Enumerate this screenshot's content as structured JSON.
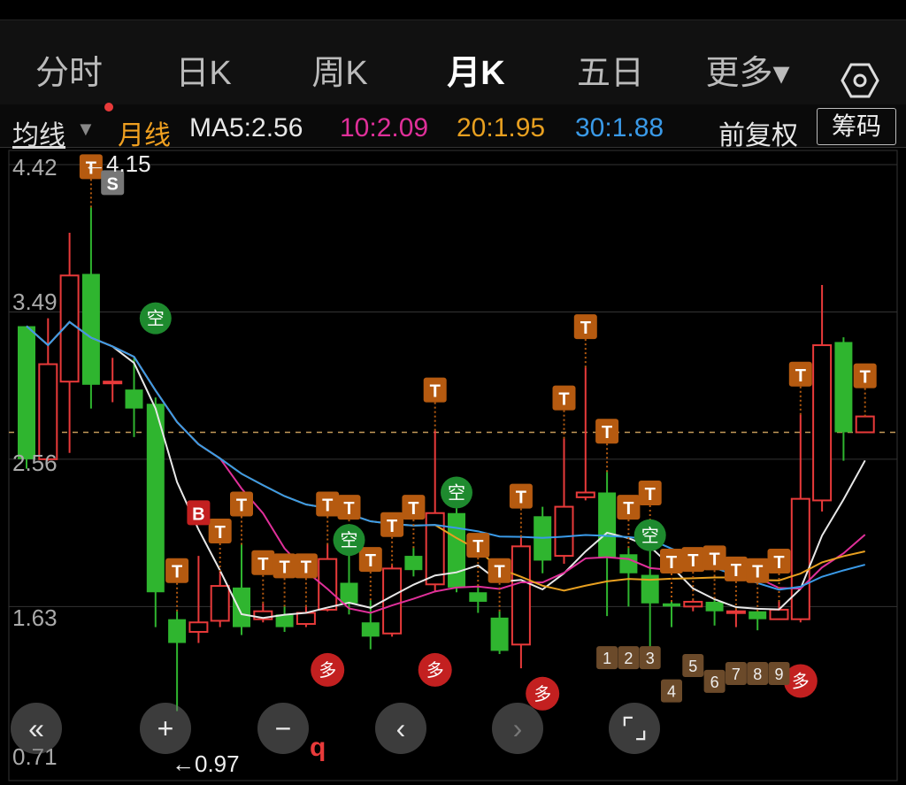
{
  "tabs": [
    {
      "label": "分时"
    },
    {
      "label": "日K"
    },
    {
      "label": "周K"
    },
    {
      "label": "月K"
    },
    {
      "label": "五日"
    },
    {
      "label": "更多▾"
    }
  ],
  "ma_bar": {
    "type_label": "均线",
    "period_label": "月线",
    "ma5": "MA5:2.56",
    "ma10": "10:2.09",
    "ma20": "20:1.95",
    "ma30": "30:1.88",
    "adjust": "前复权",
    "chips": "筹码",
    "colors": {
      "period": "#f0a020",
      "ma5": "#e8e8e8",
      "ma10": "#e0309a",
      "ma20": "#e8a020",
      "ma30": "#3a9ae8"
    }
  },
  "price_labels": {
    "top": "4.42",
    "mid_high": "3.49",
    "mid": "2.56",
    "mid_low": "1.63",
    "bottom": "0.71"
  },
  "annotations": {
    "high": "←4.15",
    "low": "←0.97"
  },
  "markers": {
    "T": "T",
    "S": "S",
    "B": "B",
    "kong": "空",
    "duo": "多",
    "numbers": [
      "1",
      "2",
      "3",
      "4",
      "5",
      "6",
      "7",
      "8",
      "9"
    ],
    "q": "q"
  },
  "colors": {
    "up": "#e83a3a",
    "down": "#2fb52f",
    "marker_t": "#b55a10",
    "kong_bg": "#1e8a2e",
    "duo_bg": "#c32020"
  },
  "chart_data": {
    "type": "candlestick",
    "ylim": [
      0.71,
      4.42
    ],
    "candles": [
      {
        "o": 2.56,
        "c": 3.4,
        "h": 3.4,
        "l": 2.5,
        "up": false
      },
      {
        "o": 2.56,
        "c": 3.16,
        "h": 3.45,
        "l": 2.55,
        "up": true
      },
      {
        "o": 3.05,
        "c": 3.72,
        "h": 3.99,
        "l": 2.6,
        "up": true
      },
      {
        "o": 3.73,
        "c": 3.03,
        "h": 4.15,
        "l": 2.88,
        "up": false
      },
      {
        "o": 3.05,
        "c": 3.05,
        "h": 3.2,
        "l": 2.92,
        "up": true
      },
      {
        "o": 3.0,
        "c": 2.88,
        "h": 3.2,
        "l": 2.7,
        "up": false
      },
      {
        "o": 2.91,
        "c": 1.72,
        "h": 2.95,
        "l": 1.5,
        "up": false
      },
      {
        "o": 1.55,
        "c": 1.4,
        "h": 1.6,
        "l": 0.97,
        "up": false
      },
      {
        "o": 1.47,
        "c": 1.53,
        "h": 1.95,
        "l": 1.4,
        "up": true
      },
      {
        "o": 1.54,
        "c": 1.76,
        "h": 1.85,
        "l": 1.5,
        "up": true
      },
      {
        "o": 1.75,
        "c": 1.5,
        "h": 2.02,
        "l": 1.45,
        "up": false
      },
      {
        "o": 1.55,
        "c": 1.6,
        "h": 1.65,
        "l": 1.53,
        "up": true
      },
      {
        "o": 1.58,
        "c": 1.5,
        "h": 1.63,
        "l": 1.47,
        "up": false
      },
      {
        "o": 1.52,
        "c": 1.59,
        "h": 1.63,
        "l": 1.5,
        "up": true
      },
      {
        "o": 1.61,
        "c": 1.93,
        "h": 2.02,
        "l": 1.6,
        "up": true
      },
      {
        "o": 1.78,
        "c": 1.65,
        "h": 2.0,
        "l": 1.58,
        "up": false
      },
      {
        "o": 1.53,
        "c": 1.44,
        "h": 1.67,
        "l": 1.36,
        "up": false
      },
      {
        "o": 1.46,
        "c": 1.87,
        "h": 1.89,
        "l": 1.44,
        "up": true
      },
      {
        "o": 1.86,
        "c": 1.95,
        "h": 2.0,
        "l": 1.82,
        "up": false
      },
      {
        "o": 1.77,
        "c": 2.22,
        "h": 2.74,
        "l": 1.73,
        "up": true
      },
      {
        "o": 2.22,
        "c": 1.75,
        "h": 2.25,
        "l": 1.72,
        "up": false
      },
      {
        "o": 1.72,
        "c": 1.66,
        "h": 1.76,
        "l": 1.59,
        "up": false
      },
      {
        "o": 1.56,
        "c": 1.35,
        "h": 1.6,
        "l": 1.33,
        "up": false
      },
      {
        "o": 1.39,
        "c": 2.01,
        "h": 2.07,
        "l": 1.24,
        "up": true
      },
      {
        "o": 2.2,
        "c": 1.92,
        "h": 2.26,
        "l": 1.84,
        "up": false
      },
      {
        "o": 1.95,
        "c": 2.26,
        "h": 2.69,
        "l": 1.9,
        "up": true
      },
      {
        "o": 2.32,
        "c": 2.35,
        "h": 3.14,
        "l": 2.3,
        "up": true
      },
      {
        "o": 2.35,
        "c": 1.94,
        "h": 2.48,
        "l": 1.57,
        "up": false
      },
      {
        "o": 1.96,
        "c": 1.84,
        "h": 2.0,
        "l": 1.63,
        "up": false
      },
      {
        "o": 1.83,
        "c": 1.65,
        "h": 2.09,
        "l": 1.36,
        "up": false
      },
      {
        "o": 1.65,
        "c": 1.63,
        "h": 1.66,
        "l": 1.5,
        "up": false
      },
      {
        "o": 1.63,
        "c": 1.66,
        "h": 1.67,
        "l": 1.6,
        "up": true
      },
      {
        "o": 1.66,
        "c": 1.6,
        "h": 1.68,
        "l": 1.51,
        "up": false
      },
      {
        "o": 1.6,
        "c": 1.59,
        "h": 1.61,
        "l": 1.5,
        "up": true
      },
      {
        "o": 1.55,
        "c": 1.6,
        "h": 1.6,
        "l": 1.48,
        "up": false
      },
      {
        "o": 1.55,
        "c": 1.61,
        "h": 1.66,
        "l": 1.55,
        "up": true
      },
      {
        "o": 1.55,
        "c": 2.31,
        "h": 2.84,
        "l": 1.53,
        "up": true
      },
      {
        "o": 2.3,
        "c": 3.28,
        "h": 3.66,
        "l": 2.23,
        "up": true
      },
      {
        "o": 3.3,
        "c": 2.73,
        "h": 3.33,
        "l": 2.55,
        "up": false
      },
      {
        "o": 2.73,
        "c": 2.83,
        "h": 2.83,
        "l": 2.73,
        "up": true
      }
    ]
  }
}
